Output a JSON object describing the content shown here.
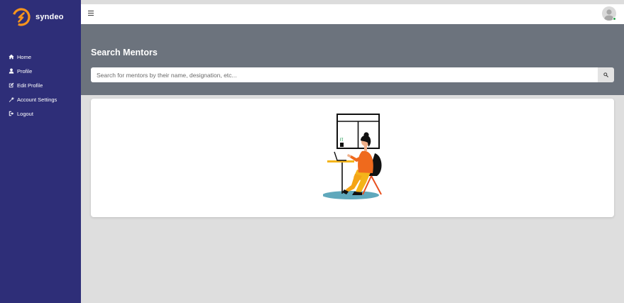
{
  "brand": {
    "name": "syndeo",
    "logo": "syndeo-logo-icon",
    "accent": "#f7941d"
  },
  "sidebar": {
    "items": [
      {
        "label": "Home",
        "icon": "home-icon"
      },
      {
        "label": "Profile",
        "icon": "user-icon"
      },
      {
        "label": "Edit Profile",
        "icon": "edit-icon"
      },
      {
        "label": "Account Settings",
        "icon": "wrench-icon"
      },
      {
        "label": "Logout",
        "icon": "logout-icon"
      }
    ],
    "background": "#2e2e78"
  },
  "topbar": {
    "menu_icon": "hamburger-icon",
    "avatar_icon": "user-avatar-icon",
    "status_color": "#2ea44f"
  },
  "hero": {
    "title": "Search Mentors",
    "search": {
      "placeholder": "Search for mentors by their name, designation, etc...",
      "value": "",
      "button_icon": "search-icon"
    },
    "background": "#6c737d"
  },
  "main": {
    "illustration": "woman-working-at-desk-illustration"
  }
}
